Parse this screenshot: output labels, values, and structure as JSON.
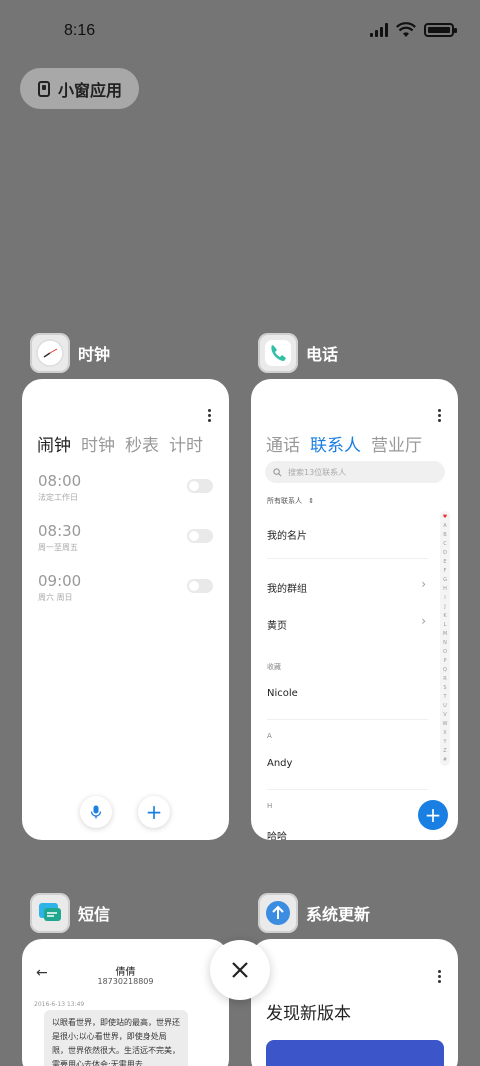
{
  "status_bar": {
    "time": "8:16"
  },
  "floating_window_button": {
    "label": "小窗应用"
  },
  "close_all": {
    "icon": "close-icon"
  },
  "apps": {
    "clock": {
      "name": "时钟",
      "icon": "clock-icon",
      "tabs": [
        "闹钟",
        "时钟",
        "秒表",
        "计时"
      ],
      "active_tab": "闹钟",
      "alarms": [
        {
          "time": "08:00",
          "desc": "法定工作日"
        },
        {
          "time": "08:30",
          "desc": "周一至周五"
        },
        {
          "time": "09:00",
          "desc": "周六 周日"
        }
      ]
    },
    "phone": {
      "name": "电话",
      "icon": "phone-icon",
      "tabs": [
        "通话",
        "联系人",
        "营业厅"
      ],
      "active_tab": "联系人",
      "search_placeholder": "搜索13位联系人",
      "filter_label": "所有联系人",
      "my_card": "我的名片",
      "my_groups": "我的群组",
      "yellow_pages": "黄页",
      "favorites_header": "收藏",
      "favorite_contact": "Nicole",
      "section_a": "A",
      "contact_a": "Andy",
      "section_h": "H",
      "contact_h": "哈哈",
      "index_letters": [
        "♥",
        "A",
        "B",
        "C",
        "D",
        "E",
        "F",
        "G",
        "H",
        "I",
        "J",
        "K",
        "L",
        "M",
        "N",
        "O",
        "P",
        "Q",
        "R",
        "S",
        "T",
        "U",
        "V",
        "W",
        "X",
        "Y",
        "Z",
        "#"
      ],
      "accent_color": "#1a7fe3"
    },
    "messages": {
      "name": "短信",
      "icon": "message-icon",
      "contact_name": "倩倩",
      "contact_number": "18730218809",
      "timestamp": "2016-6-13 13:49",
      "message_text": "以眼看世界，即使站的最高，世界还是很小;以心看世界，即使身处局限，世界依然很大。生活远不完美，需要用心去体会;无需用去"
    },
    "updater": {
      "name": "系统更新",
      "icon": "update-icon",
      "heading": "发现新版本"
    }
  }
}
